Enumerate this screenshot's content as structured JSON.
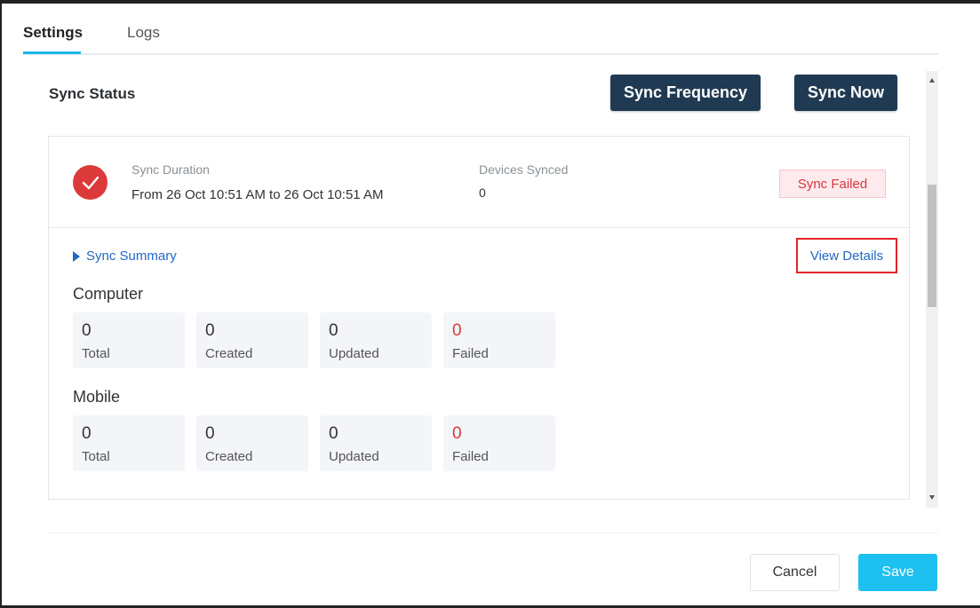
{
  "tabs": [
    {
      "label": "Settings",
      "active": true
    },
    {
      "label": "Logs",
      "active": false
    }
  ],
  "section": {
    "title": "Sync Status"
  },
  "actions": {
    "sync_frequency": "Sync Frequency",
    "sync_now": "Sync Now"
  },
  "sync": {
    "icon": "check-circle-icon",
    "duration_label": "Sync Duration",
    "duration_value": "From 26 Oct 10:51 AM to 26 Oct 10:51 AM",
    "devices_label": "Devices Synced",
    "devices_value": "0",
    "status": "Sync Failed"
  },
  "summary": {
    "toggle_label": "Sync Summary",
    "view_details": "View Details",
    "groups": [
      {
        "title": "Computer",
        "stats": [
          {
            "value": "0",
            "label": "Total"
          },
          {
            "value": "0",
            "label": "Created"
          },
          {
            "value": "0",
            "label": "Updated"
          },
          {
            "value": "0",
            "label": "Failed"
          }
        ]
      },
      {
        "title": "Mobile",
        "stats": [
          {
            "value": "0",
            "label": "Total"
          },
          {
            "value": "0",
            "label": "Created"
          },
          {
            "value": "0",
            "label": "Updated"
          },
          {
            "value": "0",
            "label": "Failed"
          }
        ]
      }
    ]
  },
  "footer": {
    "cancel": "Cancel",
    "save": "Save"
  },
  "colors": {
    "accent": "#1ab7ea",
    "dark_button": "#1f3a52",
    "failed": "#dc3a3a",
    "link": "#2268c4",
    "save": "#1ec0f0"
  }
}
